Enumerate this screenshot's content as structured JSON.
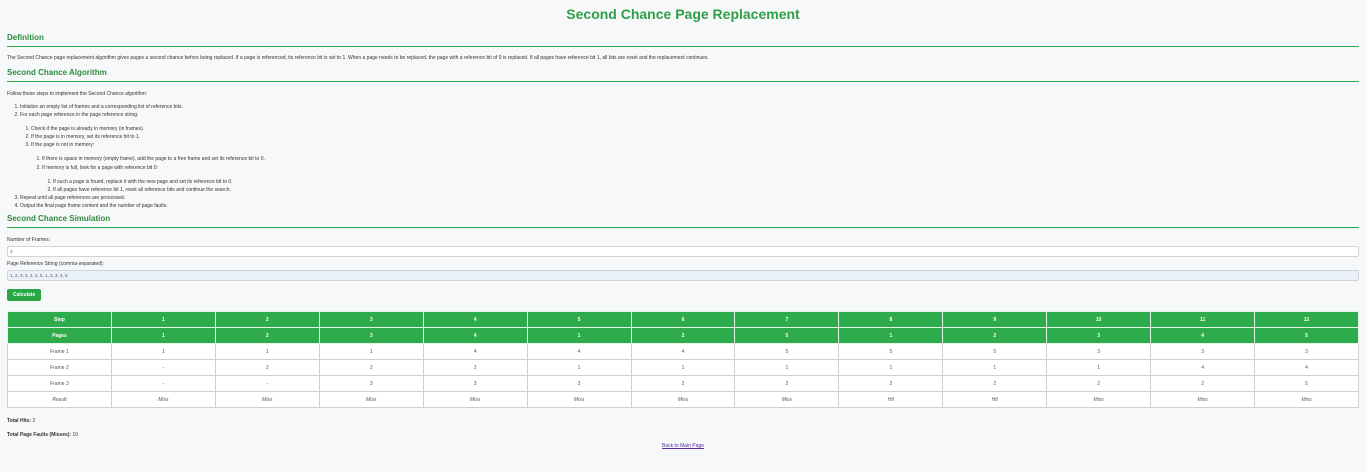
{
  "title": "Second Chance Page Replacement",
  "definition": {
    "heading": "Definition",
    "text": "The Second Chance page replacement algorithm gives pages a second chance before being replaced. If a page is referenced, its reference bit is set to 1. When a page needs to be replaced, the page with a reference bit of 0 is replaced. If all pages have reference bit 1, all bits are reset and the replacement continues."
  },
  "algorithm": {
    "heading": "Second Chance Algorithm",
    "intro": "Follow these steps to implement the Second Chance algorithm:",
    "step1": "Initialize an empty list of frames and a corresponding list of reference bits.",
    "step2": "For each page reference in the page reference string:",
    "step2_1": "Check if the page is already in memory (in frames).",
    "step2_2": "If the page is in memory, set its reference bit to 1.",
    "step2_3": "If the page is not in memory:",
    "step2_3_1": "If there is space in memory (empty frame), add the page to a free frame and set its reference bit to 0.",
    "step2_3_2": "If memory is full, look for a page with reference bit 0:",
    "step2_3_2_1": "If such a page is found, replace it with the new page and set its reference bit to 0.",
    "step2_3_2_2": "If all pages have reference bit 1, reset all reference bits and continue the search.",
    "step3": "Repeat until all page references are processed.",
    "step4": "Output the final page frame content and the number of page faults."
  },
  "simulation": {
    "heading": "Second Chance Simulation",
    "frames_label": "Number of Frames:",
    "frames_value": "3",
    "ref_label": "Page Reference String (comma-separated):",
    "ref_value": "1, 2, 3, 4, 1, 2, 5, 1, 2, 3, 4, 5",
    "calculate": "Calculate"
  },
  "table": {
    "step_label": "Step",
    "pages_label": "Pages",
    "steps": [
      "1",
      "2",
      "3",
      "4",
      "5",
      "6",
      "7",
      "8",
      "9",
      "10",
      "11",
      "12"
    ],
    "pages": [
      "1",
      "2",
      "3",
      "4",
      "1",
      "2",
      "5",
      "1",
      "2",
      "3",
      "4",
      "5"
    ],
    "frames": [
      {
        "label": "Frame 1",
        "values": [
          "1",
          "1",
          "1",
          "4",
          "4",
          "4",
          "5",
          "5",
          "5",
          "3",
          "3",
          "3"
        ]
      },
      {
        "label": "Frame 2",
        "values": [
          "-",
          "2",
          "2",
          "2",
          "1",
          "1",
          "1",
          "1",
          "1",
          "1",
          "4",
          "4"
        ]
      },
      {
        "label": "Frame 3",
        "values": [
          "-",
          "-",
          "3",
          "3",
          "3",
          "2",
          "2",
          "2",
          "2",
          "2",
          "2",
          "5"
        ]
      }
    ],
    "result_label": "Result",
    "results": [
      "Miss",
      "Miss",
      "Miss",
      "Miss",
      "Miss",
      "Miss",
      "Miss",
      "Hit",
      "Hit",
      "Miss",
      "Miss",
      "Miss"
    ]
  },
  "summary": {
    "hits_label": "Total Hits:",
    "hits_value": "2",
    "faults_label": "Total Page Faults (Misses):",
    "faults_value": "10"
  },
  "back_link": "Back to Main Page"
}
